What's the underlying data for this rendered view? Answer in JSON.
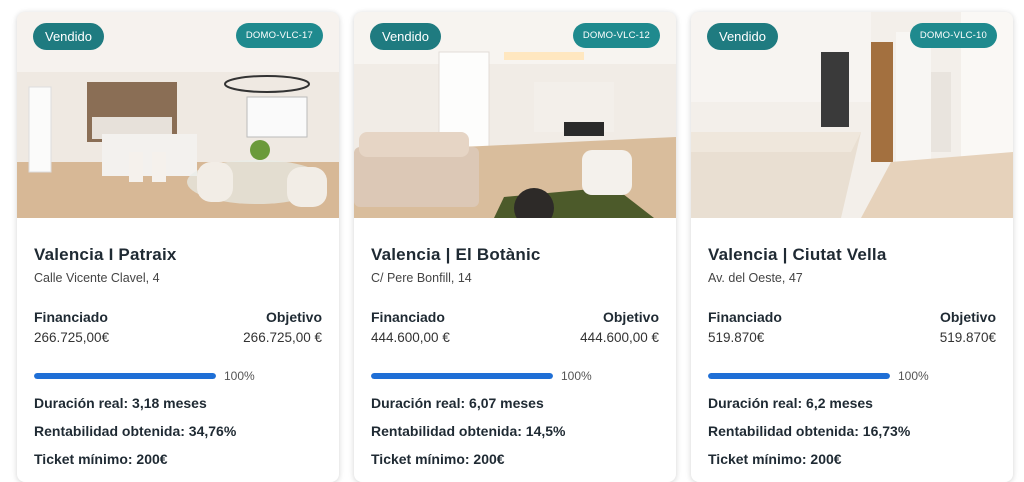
{
  "cards": [
    {
      "status": "Vendido",
      "code": "DOMO-VLC-17",
      "photo": "kitchen-dining-room-photo",
      "title": "Valencia I Patraix",
      "address": "Calle Vicente Clavel, 4",
      "funded_label": "Financiado",
      "funded_value": "266.725,00€",
      "goal_label": "Objetivo",
      "goal_value": "266.725,00 €",
      "progress": 100,
      "progress_text": "100%",
      "duration": "Duración real: 3,18 meses",
      "profitability": "Rentabilidad obtenida: 34,76%",
      "ticket": "Ticket mínimo: 200€"
    },
    {
      "status": "Vendido",
      "code": "DOMO-VLC-12",
      "photo": "living-room-photo",
      "title": "Valencia | El Botànic",
      "address": "C/ Pere Bonfill, 14",
      "funded_label": "Financiado",
      "funded_value": "444.600,00 €",
      "goal_label": "Objetivo",
      "goal_value": "444.600,00 €",
      "progress": 100,
      "progress_text": "100%",
      "duration": "Duración real: 6,07 meses",
      "profitability": "Rentabilidad obtenida: 14,5%",
      "ticket": "Ticket mínimo: 200€"
    },
    {
      "status": "Vendido",
      "code": "DOMO-VLC-10",
      "photo": "kitchen-marble-island-photo",
      "title": "Valencia | Ciutat Vella",
      "address": "Av. del Oeste, 47",
      "funded_label": "Financiado",
      "funded_value": "519.870€",
      "goal_label": "Objetivo",
      "goal_value": "519.870€",
      "progress": 100,
      "progress_text": "100%",
      "duration": "Duración real: 6,2 meses",
      "profitability": "Rentabilidad obtenida: 16,73%",
      "ticket": "Ticket mínimo: 200€"
    }
  ],
  "colors": {
    "status_badge": "#1f7b80",
    "code_badge": "#1f8a8e",
    "progress": "#1f6fd6"
  }
}
